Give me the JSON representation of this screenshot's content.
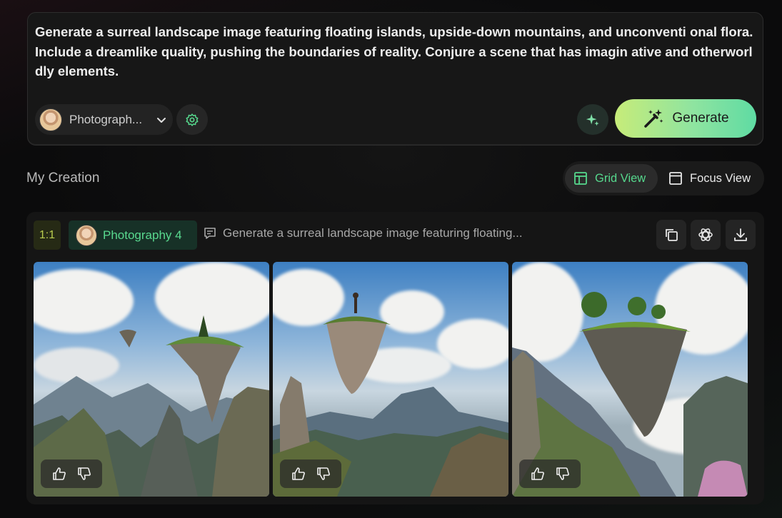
{
  "prompt": {
    "text": "Generate a surreal landscape image featuring floating islands, upside-down mountains, and unconventi onal flora. Include a dreamlike quality, pushing the boundaries of reality. Conjure a scene that has imagin ative and otherworldly elements.",
    "style_label": "Photograph...",
    "generate_label": "Generate"
  },
  "section": {
    "title": "My Creation",
    "views": [
      {
        "label": "Grid View",
        "active": true
      },
      {
        "label": "Focus View",
        "active": false
      }
    ]
  },
  "creation": {
    "ratio": "1:1",
    "style": "Photography 4",
    "prompt_preview": "Generate a surreal landscape image featuring floating...",
    "images": [
      {
        "name": "floating-islands-1"
      },
      {
        "name": "floating-head-island"
      },
      {
        "name": "floating-rock-island"
      }
    ]
  },
  "colors": {
    "accent_green": "#56d88d",
    "generate_gradient_start": "#c7ec79",
    "generate_gradient_end": "#5fdba3",
    "panel_bg": "#171717"
  },
  "icons": [
    "chevron-down-icon",
    "gear-icon",
    "sparkles-icon",
    "magic-wand-icon",
    "grid-icon",
    "window-icon",
    "prompt-icon",
    "copy-icon",
    "remix-icon",
    "download-icon",
    "thumbs-up-icon",
    "thumbs-down-icon"
  ]
}
